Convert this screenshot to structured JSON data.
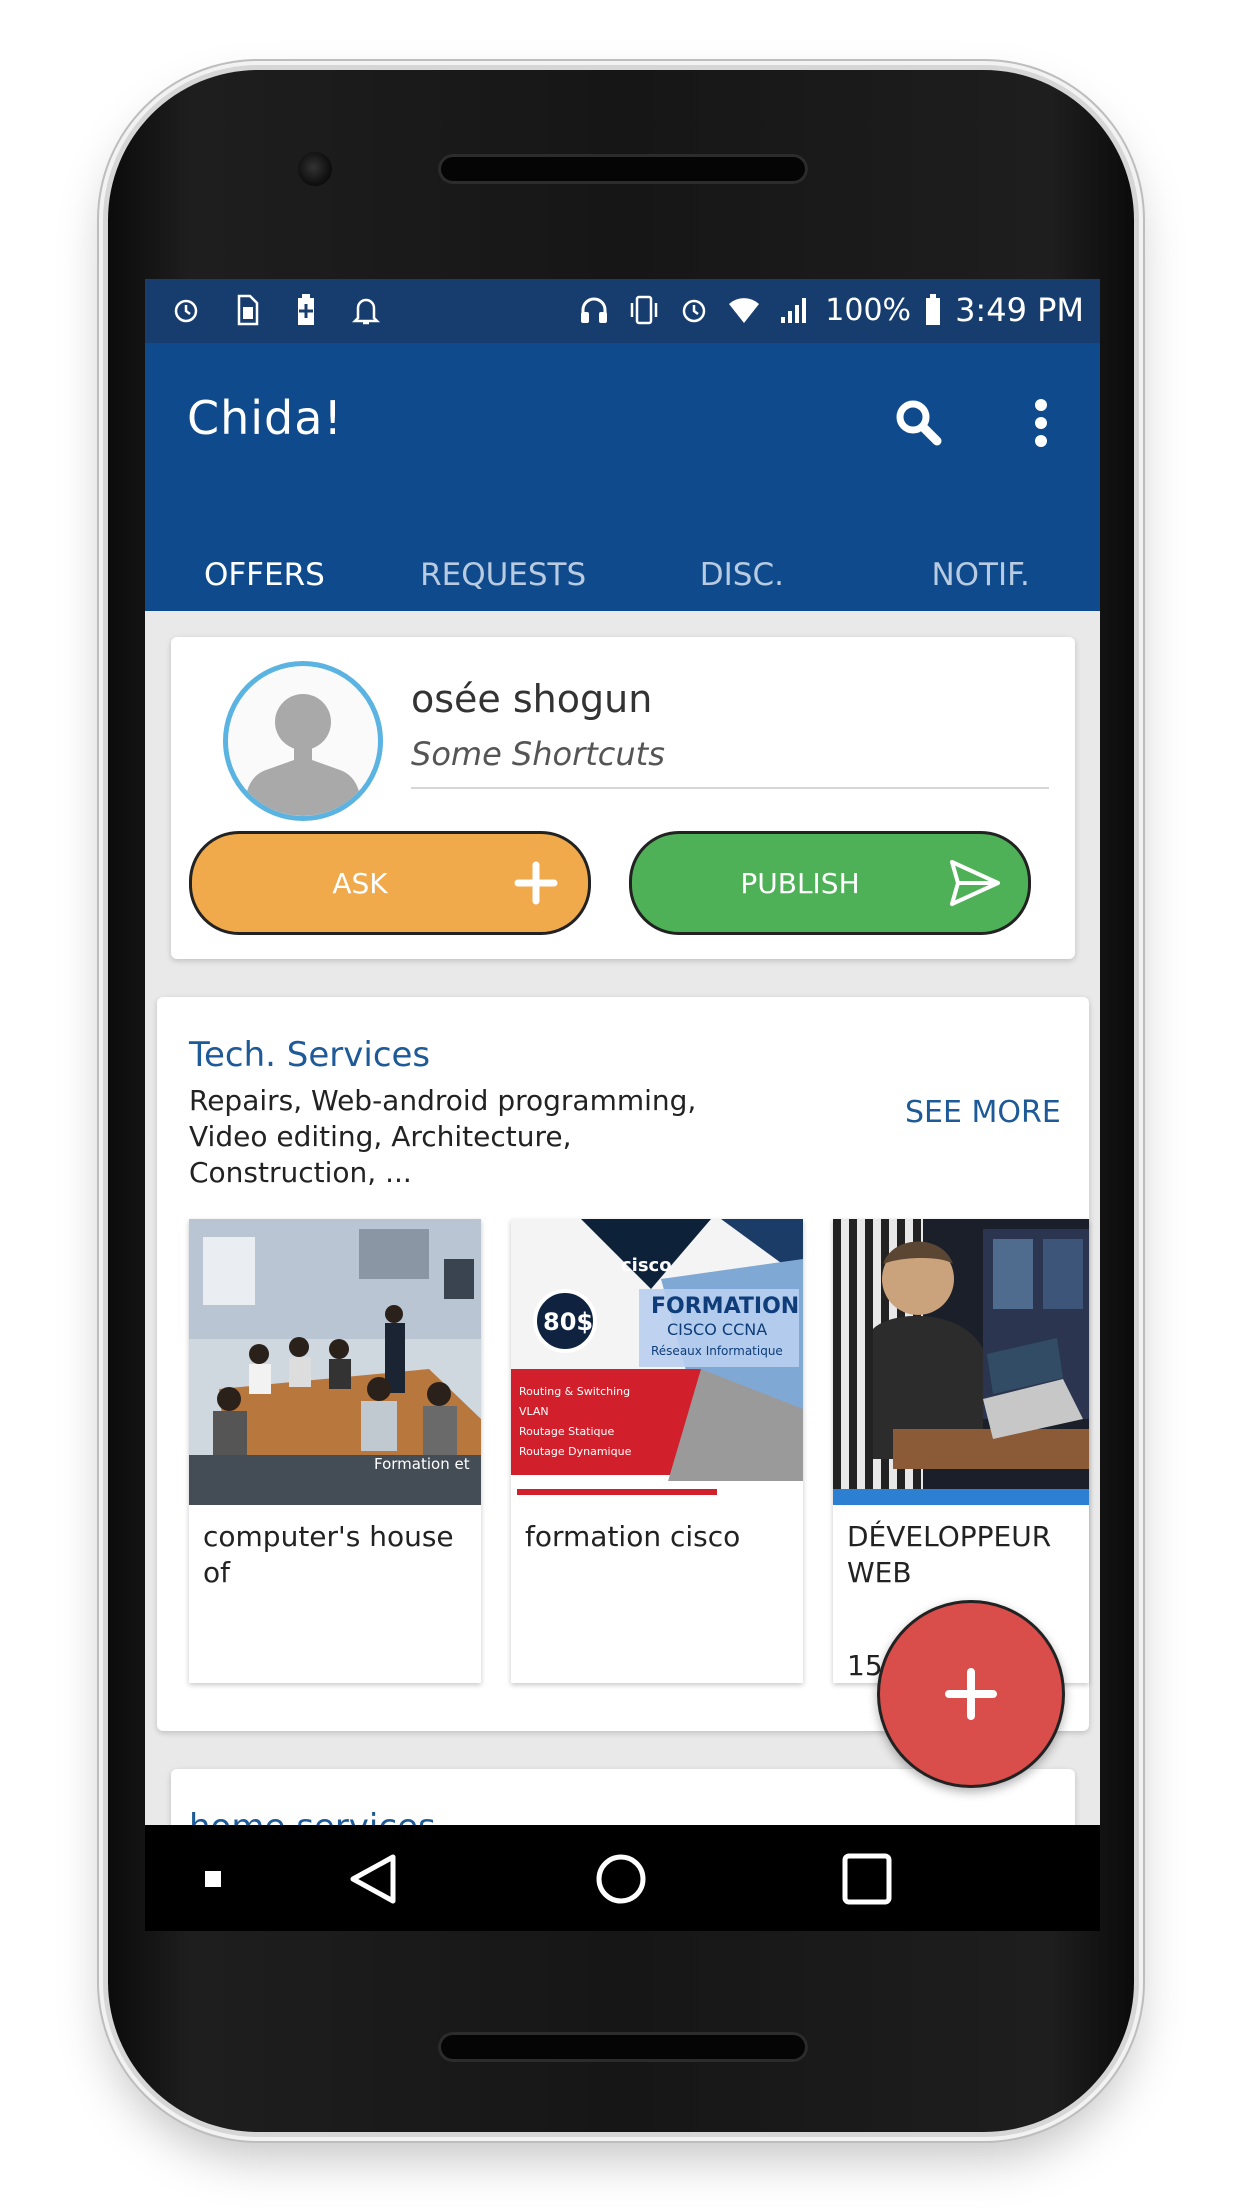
{
  "status_bar": {
    "battery": "100%",
    "time": "3:49 PM",
    "left_icons": [
      "alarm-icon",
      "sim-icon",
      "battery-charging-icon",
      "bell-icon"
    ],
    "right_icons": [
      "headset-icon",
      "vibrate-icon",
      "alarm-icon",
      "wifi-icon",
      "signal-icon",
      "battery-icon"
    ]
  },
  "app_bar": {
    "title": "Chida!",
    "search_icon": "search-icon",
    "menu_icon": "more-vert-icon",
    "background": "#0e4a8c"
  },
  "tabs": [
    {
      "label": "OFFERS",
      "active": true
    },
    {
      "label": "REQUESTS",
      "active": false
    },
    {
      "label": "DISC.",
      "active": false
    },
    {
      "label": "NOTIF.",
      "active": false
    }
  ],
  "profile": {
    "name": "osée shogun",
    "subtitle": "Some Shortcuts",
    "ask_label": "ASK",
    "publish_label": "PUBLISH",
    "ask_color": "#f0aa4b",
    "publish_color": "#4fb157"
  },
  "tech_section": {
    "title": "Tech. Services",
    "description": "Repairs, Web-android programming, Video editing, Architecture, Construction, ...",
    "see_more": "SEE MORE",
    "items": [
      {
        "title": "computer's house of",
        "image_caption": "Formation et"
      },
      {
        "title": "formation cisco",
        "image_text": {
          "brand": "cisco",
          "price": "80$",
          "headline": "FORMATION",
          "sub1": "CISCO CCNA",
          "sub2": "Réseaux Informatique",
          "bullets": [
            "Routing & Switching",
            "VLAN",
            "Routage Statique",
            "Routage Dynamique"
          ]
        }
      },
      {
        "title": "DÉVELOPPEUR WEB",
        "price_partial": "15"
      }
    ]
  },
  "next_section": {
    "title": "home services"
  },
  "fab": {
    "icon": "plus-icon",
    "color": "#d94d4a"
  },
  "nav_bar": [
    "back-icon",
    "home-icon",
    "recents-icon"
  ]
}
